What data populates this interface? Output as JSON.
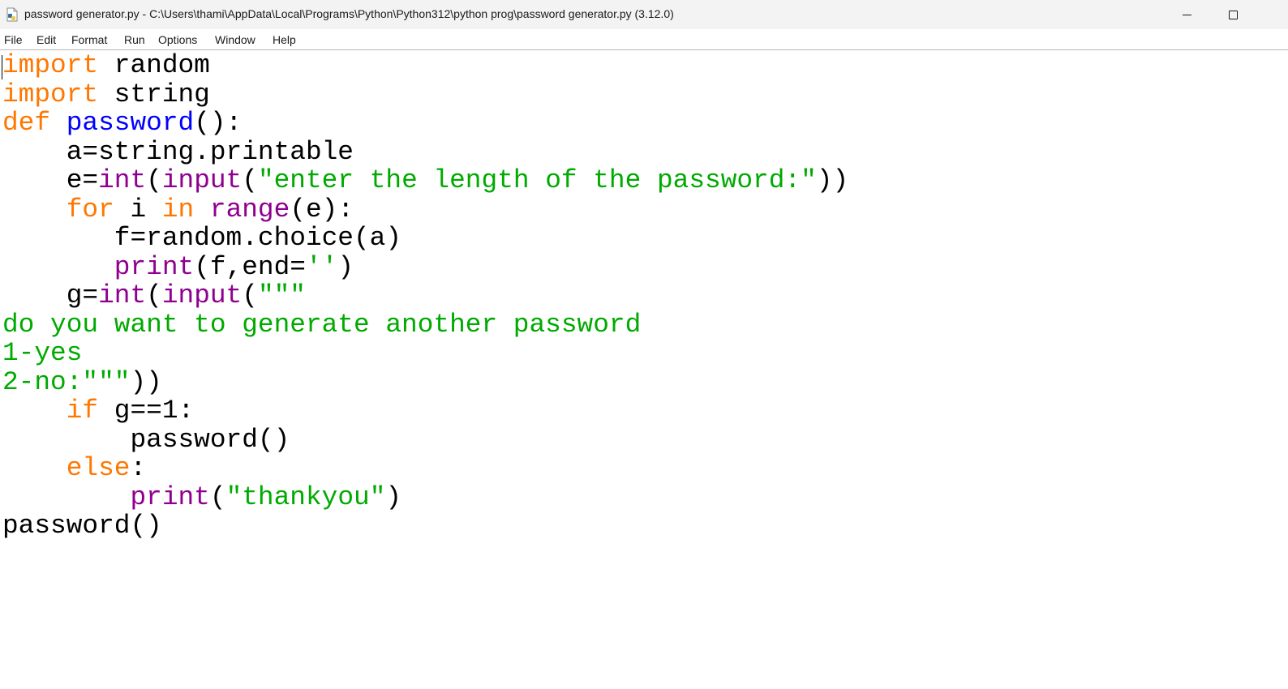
{
  "window": {
    "title": "password generator.py - C:\\Users\\thami\\AppData\\Local\\Programs\\Python\\Python312\\python prog\\password generator.py (3.12.0)",
    "icon": "python-file-icon",
    "controls": [
      "minimize-icon",
      "maximize-icon"
    ]
  },
  "menu": {
    "file": "File",
    "edit": "Edit",
    "format": "Format",
    "run": "Run",
    "options": "Options",
    "window": "Window",
    "help": "Help"
  },
  "syntax_colors": {
    "keyword": "#ff7700",
    "builtin": "#900090",
    "string": "#00aa00",
    "definition": "#0000ff",
    "default": "#000000"
  },
  "code": {
    "line1": {
      "t0": "import",
      "t1": " random"
    },
    "line2": {
      "t0": "import",
      "t1": " string"
    },
    "line3": {
      "t0": "def",
      "t1": " ",
      "t2": "password",
      "t3": "():"
    },
    "line4": {
      "t0": "    a=string.printable"
    },
    "line5": {
      "t0": "    e=",
      "t1": "int",
      "t2": "(",
      "t3": "input",
      "t4": "(",
      "t5": "\"enter the length of the password:\"",
      "t6": "))"
    },
    "line6": {
      "t0": "    ",
      "t1": "for",
      "t2": " i ",
      "t3": "in",
      "t4": " ",
      "t5": "range",
      "t6": "(e):"
    },
    "line7": {
      "t0": "       f=random.choice(a)"
    },
    "line8": {
      "t0": "       ",
      "t1": "print",
      "t2": "(f,end=",
      "t3": "''",
      "t4": ")"
    },
    "line9": {
      "t0": "    g=",
      "t1": "int",
      "t2": "(",
      "t3": "input",
      "t4": "(",
      "t5": "\"\"\""
    },
    "line10": {
      "t0": "do you want to generate another password"
    },
    "line11": {
      "t0": "1-yes"
    },
    "line12": {
      "t0": "2-no:\"\"\"",
      "t1": "))"
    },
    "line13": {
      "t0": "    ",
      "t1": "if",
      "t2": " g==1:"
    },
    "line14": {
      "t0": "        password()"
    },
    "line15": {
      "t0": "    ",
      "t1": "else",
      "t2": ":"
    },
    "line16": {
      "t0": "        ",
      "t1": "print",
      "t2": "(",
      "t3": "\"thankyou\"",
      "t4": ")"
    },
    "line17": {
      "t0": "password()"
    }
  }
}
